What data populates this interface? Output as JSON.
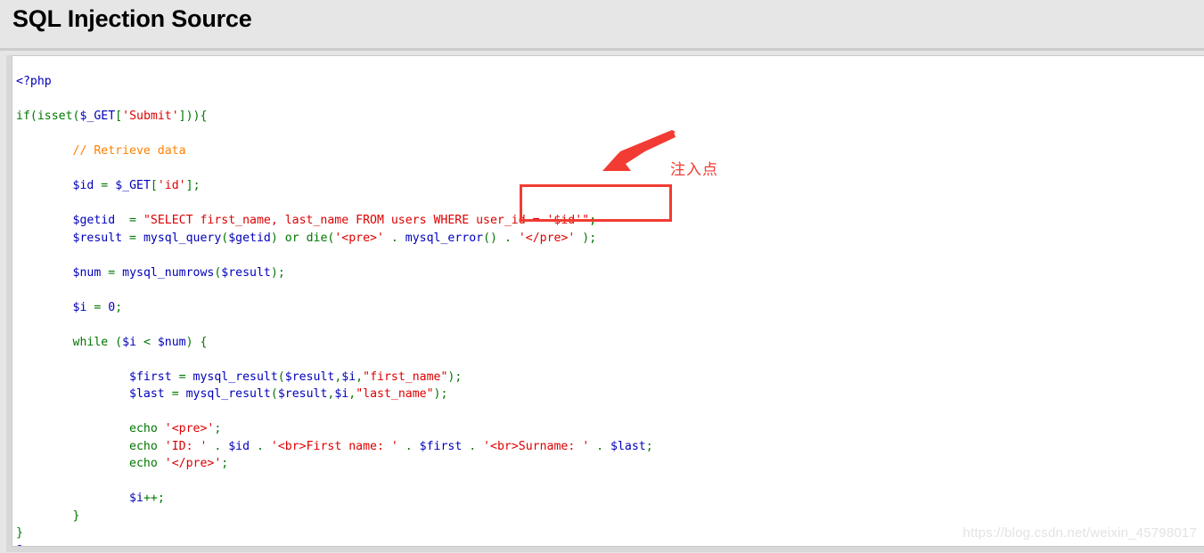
{
  "header": {
    "title": "SQL Injection Source"
  },
  "code": {
    "language": "php",
    "lines": [
      [
        {
          "t": "<?php",
          "c": "php"
        }
      ],
      [],
      [
        {
          "t": "if(isset(",
          "c": "kw"
        },
        {
          "t": "$_GET",
          "c": "var"
        },
        {
          "t": "[",
          "c": "punc"
        },
        {
          "t": "'Submit'",
          "c": "str"
        },
        {
          "t": "]",
          "c": "punc"
        },
        {
          "t": "))",
          "c": "kw"
        },
        {
          "t": "{",
          "c": "punc"
        }
      ],
      [],
      [
        {
          "t": "        ",
          "c": "plain"
        },
        {
          "t": "// Retrieve data",
          "c": "cmt"
        }
      ],
      [],
      [
        {
          "t": "        ",
          "c": "plain"
        },
        {
          "t": "$id",
          "c": "var"
        },
        {
          "t": " = ",
          "c": "kw"
        },
        {
          "t": "$_GET",
          "c": "var"
        },
        {
          "t": "[",
          "c": "punc"
        },
        {
          "t": "'id'",
          "c": "str"
        },
        {
          "t": "]",
          "c": "punc"
        },
        {
          "t": ";",
          "c": "kw"
        }
      ],
      [],
      [
        {
          "t": "        ",
          "c": "plain"
        },
        {
          "t": "$getid",
          "c": "var"
        },
        {
          "t": "  = ",
          "c": "kw"
        },
        {
          "t": "\"SELECT first_name, last_name FROM users WHERE user_id = '$id'\"",
          "c": "str"
        },
        {
          "t": ";",
          "c": "kw"
        }
      ],
      [
        {
          "t": "        ",
          "c": "plain"
        },
        {
          "t": "$result",
          "c": "var"
        },
        {
          "t": " = ",
          "c": "kw"
        },
        {
          "t": "mysql_query",
          "c": "fn"
        },
        {
          "t": "(",
          "c": "punc"
        },
        {
          "t": "$getid",
          "c": "var"
        },
        {
          "t": ") or ",
          "c": "kw"
        },
        {
          "t": "die",
          "c": "kw"
        },
        {
          "t": "(",
          "c": "punc"
        },
        {
          "t": "'<pre>'",
          "c": "str"
        },
        {
          "t": " . ",
          "c": "kw"
        },
        {
          "t": "mysql_error",
          "c": "fn"
        },
        {
          "t": "()",
          "c": "punc"
        },
        {
          "t": " . ",
          "c": "kw"
        },
        {
          "t": "'</pre>'",
          "c": "str"
        },
        {
          "t": " );",
          "c": "punc"
        }
      ],
      [],
      [
        {
          "t": "        ",
          "c": "plain"
        },
        {
          "t": "$num",
          "c": "var"
        },
        {
          "t": " = ",
          "c": "kw"
        },
        {
          "t": "mysql_numrows",
          "c": "fn"
        },
        {
          "t": "(",
          "c": "punc"
        },
        {
          "t": "$result",
          "c": "var"
        },
        {
          "t": ");",
          "c": "punc"
        }
      ],
      [],
      [
        {
          "t": "        ",
          "c": "plain"
        },
        {
          "t": "$i",
          "c": "var"
        },
        {
          "t": " = ",
          "c": "kw"
        },
        {
          "t": "0",
          "c": "var"
        },
        {
          "t": ";",
          "c": "kw"
        }
      ],
      [],
      [
        {
          "t": "        ",
          "c": "plain"
        },
        {
          "t": "while ",
          "c": "kw"
        },
        {
          "t": "(",
          "c": "punc"
        },
        {
          "t": "$i",
          "c": "var"
        },
        {
          "t": " < ",
          "c": "kw"
        },
        {
          "t": "$num",
          "c": "var"
        },
        {
          "t": ") ",
          "c": "punc"
        },
        {
          "t": "{",
          "c": "punc"
        }
      ],
      [],
      [
        {
          "t": "                ",
          "c": "plain"
        },
        {
          "t": "$first",
          "c": "var"
        },
        {
          "t": " = ",
          "c": "kw"
        },
        {
          "t": "mysql_result",
          "c": "fn"
        },
        {
          "t": "(",
          "c": "punc"
        },
        {
          "t": "$result",
          "c": "var"
        },
        {
          "t": ",",
          "c": "kw"
        },
        {
          "t": "$i",
          "c": "var"
        },
        {
          "t": ",",
          "c": "kw"
        },
        {
          "t": "\"first_name\"",
          "c": "str"
        },
        {
          "t": ");",
          "c": "punc"
        }
      ],
      [
        {
          "t": "                ",
          "c": "plain"
        },
        {
          "t": "$last",
          "c": "var"
        },
        {
          "t": " = ",
          "c": "kw"
        },
        {
          "t": "mysql_result",
          "c": "fn"
        },
        {
          "t": "(",
          "c": "punc"
        },
        {
          "t": "$result",
          "c": "var"
        },
        {
          "t": ",",
          "c": "kw"
        },
        {
          "t": "$i",
          "c": "var"
        },
        {
          "t": ",",
          "c": "kw"
        },
        {
          "t": "\"last_name\"",
          "c": "str"
        },
        {
          "t": ");",
          "c": "punc"
        }
      ],
      [],
      [
        {
          "t": "                ",
          "c": "plain"
        },
        {
          "t": "echo ",
          "c": "kw"
        },
        {
          "t": "'<pre>'",
          "c": "str"
        },
        {
          "t": ";",
          "c": "kw"
        }
      ],
      [
        {
          "t": "                ",
          "c": "plain"
        },
        {
          "t": "echo ",
          "c": "kw"
        },
        {
          "t": "'ID: '",
          "c": "str"
        },
        {
          "t": " . ",
          "c": "kw"
        },
        {
          "t": "$id",
          "c": "var"
        },
        {
          "t": " . ",
          "c": "kw"
        },
        {
          "t": "'<br>First name: '",
          "c": "str"
        },
        {
          "t": " . ",
          "c": "kw"
        },
        {
          "t": "$first",
          "c": "var"
        },
        {
          "t": " . ",
          "c": "kw"
        },
        {
          "t": "'<br>Surname: '",
          "c": "str"
        },
        {
          "t": " . ",
          "c": "kw"
        },
        {
          "t": "$last",
          "c": "var"
        },
        {
          "t": ";",
          "c": "kw"
        }
      ],
      [
        {
          "t": "                ",
          "c": "plain"
        },
        {
          "t": "echo ",
          "c": "kw"
        },
        {
          "t": "'</pre>'",
          "c": "str"
        },
        {
          "t": ";",
          "c": "kw"
        }
      ],
      [],
      [
        {
          "t": "                ",
          "c": "plain"
        },
        {
          "t": "$i",
          "c": "var"
        },
        {
          "t": "++",
          "c": "kw"
        },
        {
          "t": ";",
          "c": "kw"
        }
      ],
      [
        {
          "t": "        ",
          "c": "plain"
        },
        {
          "t": "}",
          "c": "punc"
        }
      ],
      [
        {
          "t": "}",
          "c": "punc"
        }
      ],
      [
        {
          "t": "?>",
          "c": "php"
        }
      ]
    ]
  },
  "annotation": {
    "label": "注入点",
    "arrow_color": "#f23b32",
    "box_color": "#f23b32",
    "highlighted_fragment": "user_id = '$id'\";"
  },
  "watermark": {
    "text": "https://blog.csdn.net/weixin_45798017"
  },
  "colors": {
    "page_background": "#e6e6e6",
    "code_background": "#ffffff",
    "divider": "#cccccc",
    "token_keyword": "#007700",
    "token_variable": "#0000bb",
    "token_string": "#dd0000",
    "token_comment": "#ff8000",
    "token_php_tag": "#0000bb"
  }
}
